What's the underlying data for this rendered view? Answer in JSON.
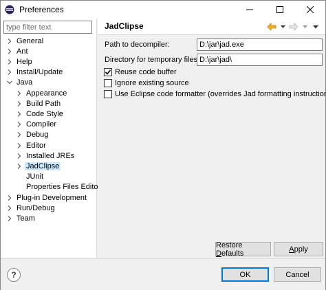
{
  "window": {
    "title": "Preferences"
  },
  "filter": {
    "placeholder": "type filter text"
  },
  "tree": {
    "items": [
      {
        "label": "General",
        "level": 0,
        "expandable": true,
        "expanded": false
      },
      {
        "label": "Ant",
        "level": 0,
        "expandable": true,
        "expanded": false
      },
      {
        "label": "Help",
        "level": 0,
        "expandable": true,
        "expanded": false
      },
      {
        "label": "Install/Update",
        "level": 0,
        "expandable": true,
        "expanded": false
      },
      {
        "label": "Java",
        "level": 0,
        "expandable": true,
        "expanded": true
      },
      {
        "label": "Appearance",
        "level": 1,
        "expandable": true,
        "expanded": false
      },
      {
        "label": "Build Path",
        "level": 1,
        "expandable": true,
        "expanded": false
      },
      {
        "label": "Code Style",
        "level": 1,
        "expandable": true,
        "expanded": false
      },
      {
        "label": "Compiler",
        "level": 1,
        "expandable": true,
        "expanded": false
      },
      {
        "label": "Debug",
        "level": 1,
        "expandable": true,
        "expanded": false
      },
      {
        "label": "Editor",
        "level": 1,
        "expandable": true,
        "expanded": false
      },
      {
        "label": "Installed JREs",
        "level": 1,
        "expandable": true,
        "expanded": false
      },
      {
        "label": "JadClipse",
        "level": 1,
        "expandable": true,
        "expanded": false,
        "selected": true
      },
      {
        "label": "JUnit",
        "level": 1,
        "expandable": false
      },
      {
        "label": "Properties Files Edito",
        "level": 1,
        "expandable": false
      },
      {
        "label": "Plug-in Development",
        "level": 0,
        "expandable": true,
        "expanded": false
      },
      {
        "label": "Run/Debug",
        "level": 0,
        "expandable": true,
        "expanded": false
      },
      {
        "label": "Team",
        "level": 0,
        "expandable": true,
        "expanded": false
      }
    ]
  },
  "page": {
    "title": "JadClipse",
    "decompiler_label": "Path to decompiler:",
    "decompiler_value": "D:\\jar\\jad.exe",
    "tempdir_label": "Directory for temporary files:",
    "tempdir_value": "D:\\jar\\jad\\",
    "options": [
      {
        "label": "Reuse code buffer",
        "checked": true
      },
      {
        "label": "Ignore existing source",
        "checked": false
      },
      {
        "label": "Use Eclipse code formatter (overrides Jad formatting instructions)",
        "checked": false
      }
    ],
    "restore_defaults_label": "Restore Defaults",
    "apply_label": "Apply"
  },
  "footer": {
    "ok_label": "OK",
    "cancel_label": "Cancel"
  },
  "colors": {
    "selection": "#cce8ff",
    "nav_back": "#e8a000",
    "default_button_border": "#0078d7"
  },
  "icons": [
    "eclipse-icon",
    "minimize-icon",
    "maximize-icon",
    "close-icon",
    "back-icon",
    "forward-icon",
    "menu-icon",
    "help-icon"
  ]
}
